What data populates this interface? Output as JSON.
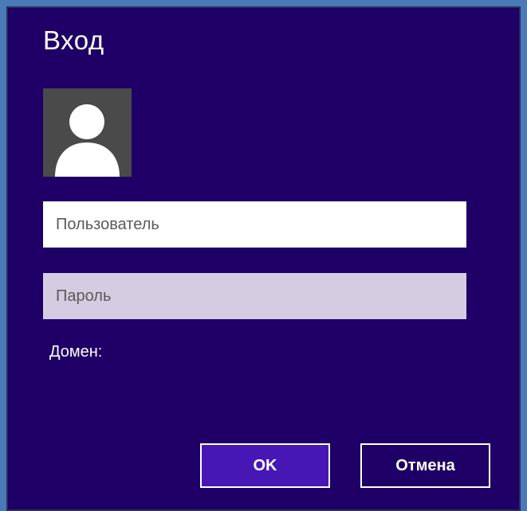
{
  "dialog": {
    "title": "Вход",
    "avatar_icon": "user-silhouette-icon",
    "username": {
      "value": "",
      "placeholder": "Пользователь"
    },
    "password": {
      "value": "",
      "placeholder": "Пароль"
    },
    "domain_label": "Домен:",
    "buttons": {
      "ok": "OK",
      "cancel": "Отмена"
    }
  },
  "colors": {
    "dialog_background": "#1e0066",
    "ok_button": "#4617b4",
    "password_field": "#d4cde1",
    "avatar_background": "#4a4a4a",
    "outer_background": "#4a7ab8"
  }
}
